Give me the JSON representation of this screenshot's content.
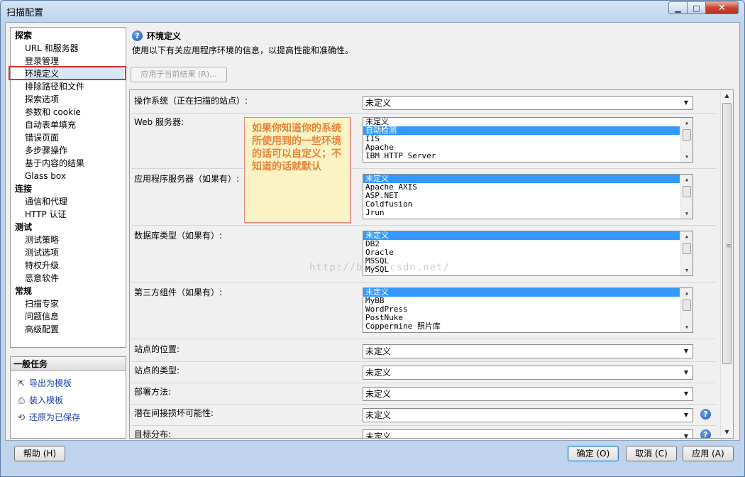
{
  "window": {
    "title": "扫描配置"
  },
  "sidebar": {
    "items": [
      {
        "label": "探索",
        "type": "category"
      },
      {
        "label": "URL 和服务器",
        "type": "item"
      },
      {
        "label": "登录管理",
        "type": "item"
      },
      {
        "label": "环境定义",
        "type": "item",
        "selected": true
      },
      {
        "label": "排除路径和文件",
        "type": "item"
      },
      {
        "label": "探索选项",
        "type": "item"
      },
      {
        "label": "参数和 cookie",
        "type": "item"
      },
      {
        "label": "自动表单填充",
        "type": "item"
      },
      {
        "label": "错误页面",
        "type": "item"
      },
      {
        "label": "多步骤操作",
        "type": "item"
      },
      {
        "label": "基于内容的结果",
        "type": "item"
      },
      {
        "label": "Glass box",
        "type": "item"
      },
      {
        "label": "连接",
        "type": "category"
      },
      {
        "label": "通信和代理",
        "type": "item"
      },
      {
        "label": "HTTP 认证",
        "type": "item"
      },
      {
        "label": "测试",
        "type": "category"
      },
      {
        "label": "测试策略",
        "type": "item"
      },
      {
        "label": "测试选项",
        "type": "item"
      },
      {
        "label": "特权升级",
        "type": "item"
      },
      {
        "label": "恶意软件",
        "type": "item"
      },
      {
        "label": "常规",
        "type": "category"
      },
      {
        "label": "扫描专家",
        "type": "item"
      },
      {
        "label": "问题信息",
        "type": "item"
      },
      {
        "label": "高级配置",
        "type": "item"
      }
    ]
  },
  "tasks": {
    "header": "一般任务",
    "links": [
      {
        "label": "导出为模板",
        "icon": "export-icon"
      },
      {
        "label": "装入模板",
        "icon": "load-icon"
      },
      {
        "label": "还原为已保存",
        "icon": "restore-icon"
      }
    ]
  },
  "main": {
    "title": "环境定义",
    "subtitle": "使用以下有关应用程序环境的信息，以提高性能和准确性。",
    "apply_current_label": "应用于当前结果 (R)..."
  },
  "form": {
    "os": {
      "label": "操作系统（正在扫描的站点）:",
      "value": "未定义"
    },
    "web_server": {
      "label": "Web 服务器:",
      "options": [
        "未定义",
        "自动检测",
        "IIS",
        "Apache",
        "IBM HTTP Server"
      ],
      "selected": 1
    },
    "app_server": {
      "label": "应用程序服务器（如果有）:",
      "options": [
        "未定义",
        "Apache AXIS",
        "ASP.NET",
        "Coldfusion",
        "Jrun"
      ],
      "selected": 0
    },
    "database": {
      "label": "数据库类型（如果有）:",
      "options": [
        "未定义",
        "DB2",
        "Oracle",
        "MSSQL",
        "MySQL"
      ],
      "selected": 0
    },
    "third_party": {
      "label": "第三方组件（如果有）:",
      "options": [
        "未定义",
        "MyBB",
        "WordPress",
        "PostNuke",
        "Coppermine 照片库"
      ],
      "selected": 0
    },
    "site_location": {
      "label": "站点的位置:",
      "value": "未定义"
    },
    "site_type": {
      "label": "站点的类型:",
      "value": "未定义"
    },
    "deployment": {
      "label": "部署方法:",
      "value": "未定义"
    },
    "collateral_damage": {
      "label": "潜在间接损坏可能性:",
      "value": "未定义"
    },
    "target_distribution": {
      "label": "目标分布:",
      "value": "未定义"
    }
  },
  "annotation": {
    "text": "如果你知道你的系统所使用到的一些环境的话可以自定义；不知道的话就默认"
  },
  "watermark": "http://blog.csdn.net/",
  "footer": {
    "help_label": "帮助 (H)",
    "ok_label": "确定 (O)",
    "cancel_label": "取消 (C)",
    "apply_label": "应用 (A)"
  }
}
